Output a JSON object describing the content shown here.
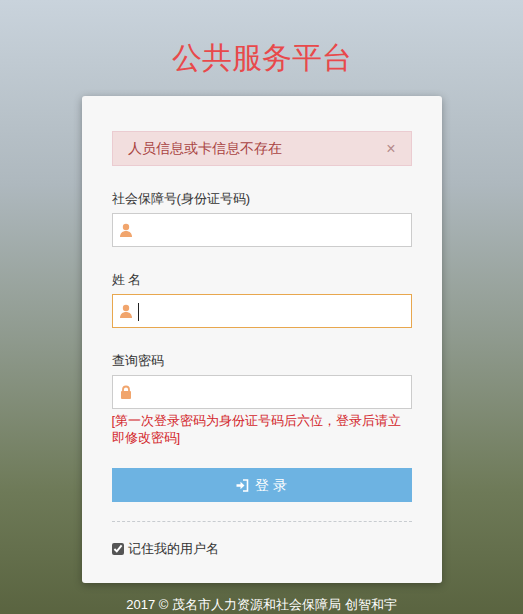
{
  "title": "公共服务平台",
  "alert": {
    "message": "人员信息或卡信息不存在",
    "close": "×"
  },
  "fields": [
    {
      "label": "社会保障号(身份证号码)",
      "focused": false,
      "kind": "user"
    },
    {
      "label": "姓 名",
      "focused": true,
      "kind": "user"
    },
    {
      "label": "查询密码",
      "focused": false,
      "kind": "lock"
    }
  ],
  "hint": "[第一次登录密码为身份证号码后六位，登录后请立即修改密码]",
  "login_button": "登 录",
  "remember": {
    "label": "记住我的用户名",
    "checked": true
  },
  "footer": "2017 © 茂名市人力资源和社会保障局 创智和宇"
}
